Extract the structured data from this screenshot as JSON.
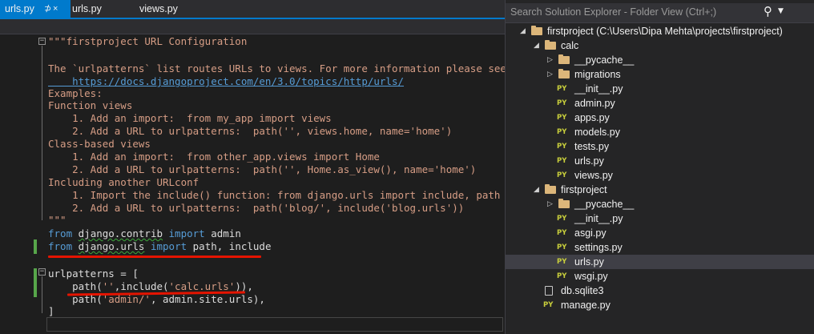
{
  "tabs": [
    {
      "label": "urls.py",
      "pin": "⊅",
      "close": "×"
    },
    {
      "label": "urls.py"
    },
    {
      "label": "views.py"
    }
  ],
  "editor": {
    "lines": [
      "\"\"\"firstproject URL Configuration",
      "",
      "The `urlpatterns` list routes URLs to views. For more information please see:",
      "    https://docs.djangoproject.com/en/3.0/topics/http/urls/",
      "Examples:",
      "Function views",
      "    1. Add an import:  from my_app import views",
      "    2. Add a URL to urlpatterns:  path('', views.home, name='home')",
      "Class-based views",
      "    1. Add an import:  from other_app.views import Home",
      "    2. Add a URL to urlpatterns:  path('', Home.as_view(), name='home')",
      "Including another URLconf",
      "    1. Import the include() function: from django.urls import include, path",
      "    2. Add a URL to urlpatterns:  path('blog/', include('blog.urls'))",
      "\"\"\""
    ],
    "code1": {
      "from": "from",
      "mod": "django.contrib",
      "import": "import",
      "rest": " admin"
    },
    "code2": {
      "from": "from",
      "mod": "django.urls",
      "import": "import",
      "rest": " path, include"
    },
    "code3": "urlpatterns = [",
    "code4": {
      "a": "    path(",
      "s1": "''",
      "b": ",include(",
      "s2": "'calc.urls'",
      "c": ")),"
    },
    "code5": {
      "a": "    path(",
      "s1": "'admin/'",
      "b": ", admin.site.urls),"
    },
    "code6": "]"
  },
  "explorer": {
    "search_placeholder": "Search Solution Explorer - Folder View (Ctrl+;)",
    "search_icon": "⚲",
    "items": [
      {
        "label": "firstproject (C:\\Users\\Dipa Mehta\\projects\\firstproject)",
        "type": "folder",
        "level": 0,
        "arrow": "◢"
      },
      {
        "label": "calc",
        "type": "folder",
        "level": 1,
        "arrow": "◢"
      },
      {
        "label": "__pycache__",
        "type": "folder",
        "level": 2,
        "arrow": "▷"
      },
      {
        "label": "migrations",
        "type": "folder",
        "level": 2,
        "arrow": "▷"
      },
      {
        "label": "__init__.py",
        "type": "py",
        "level": 2
      },
      {
        "label": "admin.py",
        "type": "py",
        "level": 2
      },
      {
        "label": "apps.py",
        "type": "py",
        "level": 2
      },
      {
        "label": "models.py",
        "type": "py",
        "level": 2
      },
      {
        "label": "tests.py",
        "type": "py",
        "level": 2
      },
      {
        "label": "urls.py",
        "type": "py",
        "level": 2
      },
      {
        "label": "views.py",
        "type": "py",
        "level": 2
      },
      {
        "label": "firstproject",
        "type": "folder",
        "level": 1,
        "arrow": "◢"
      },
      {
        "label": "__pycache__",
        "type": "folder",
        "level": 2,
        "arrow": "▷"
      },
      {
        "label": "__init__.py",
        "type": "py",
        "level": 2
      },
      {
        "label": "asgi.py",
        "type": "py",
        "level": 2
      },
      {
        "label": "settings.py",
        "type": "py",
        "level": 2
      },
      {
        "label": "urls.py",
        "type": "py",
        "level": 2,
        "selected": true
      },
      {
        "label": "wsgi.py",
        "type": "py",
        "level": 2
      },
      {
        "label": "db.sqlite3",
        "type": "db",
        "level": 1
      },
      {
        "label": "manage.py",
        "type": "py",
        "level": 1
      }
    ],
    "py_badge": "PY"
  },
  "colors": {
    "accent": "#007acc",
    "docstring": "#d69d85",
    "keyword": "#569cd6",
    "annotation": "#e51400"
  }
}
